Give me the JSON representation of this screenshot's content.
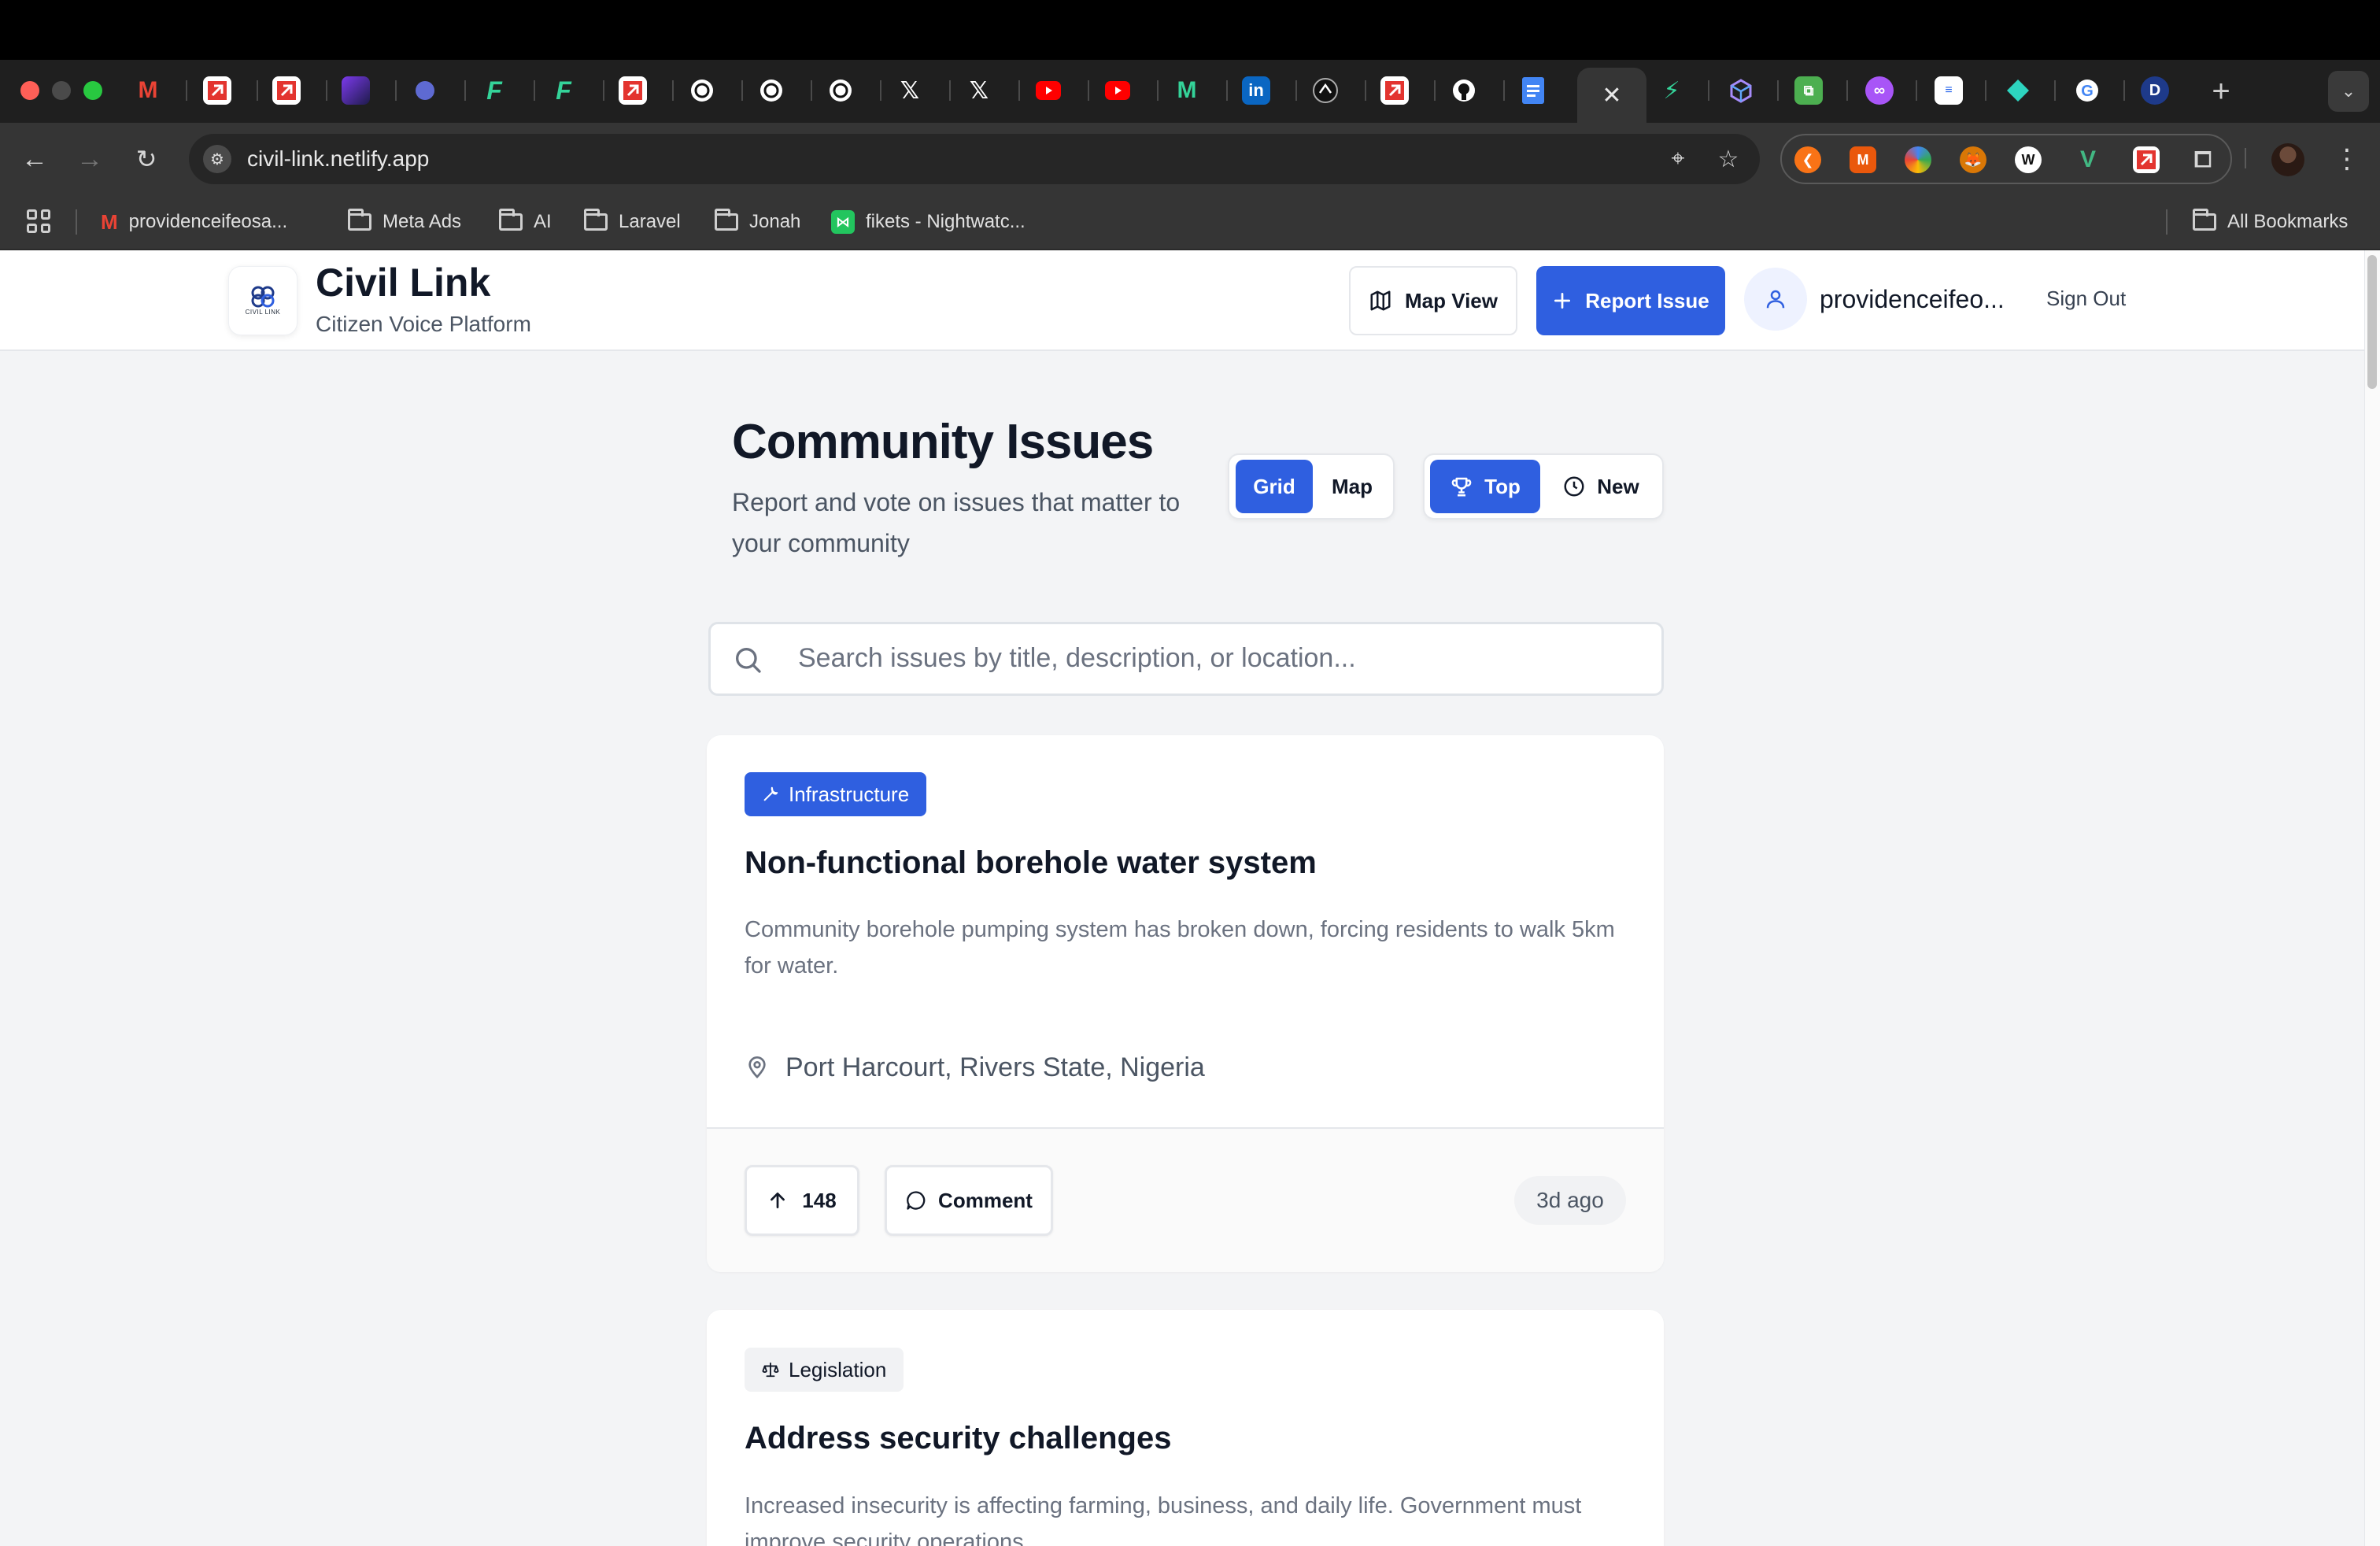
{
  "browser": {
    "url": "civil-link.netlify.app",
    "colors": {
      "frame": "#1f1f1f",
      "toolbar": "#353535",
      "omnibox": "#262626"
    },
    "tabs": [
      {
        "icon": "gmail-icon"
      },
      {
        "icon": "laravel-cloud-icon"
      },
      {
        "icon": "laravel-cloud-icon"
      },
      {
        "icon": "purple-app-icon"
      },
      {
        "icon": "linear-icon"
      },
      {
        "icon": "f-app-icon"
      },
      {
        "icon": "f-app-icon"
      },
      {
        "icon": "laravel-cloud-icon"
      },
      {
        "icon": "chatgpt-icon"
      },
      {
        "icon": "chatgpt-icon"
      },
      {
        "icon": "chatgpt-icon"
      },
      {
        "icon": "x-icon"
      },
      {
        "icon": "x-icon"
      },
      {
        "icon": "youtube-icon"
      },
      {
        "icon": "youtube-icon"
      },
      {
        "icon": "m-app-icon"
      },
      {
        "icon": "linkedin-icon"
      },
      {
        "icon": "ai-app-icon"
      },
      {
        "icon": "laravel-cloud-icon"
      },
      {
        "icon": "github-icon"
      },
      {
        "icon": "google-docs-icon"
      },
      {
        "icon": "close-icon",
        "active": true
      },
      {
        "icon": "bolt-icon"
      },
      {
        "icon": "cube-icon"
      },
      {
        "icon": "green-app-icon"
      },
      {
        "icon": "purple-loop-icon"
      },
      {
        "icon": "doc-app-icon"
      },
      {
        "icon": "teal-diamond-icon"
      },
      {
        "icon": "google-icon"
      },
      {
        "icon": "d-app-icon"
      }
    ],
    "bookmarks": [
      {
        "label": "providenceifeosa...",
        "icon": "gmail-icon"
      },
      {
        "label": "Meta Ads",
        "icon": "folder-icon"
      },
      {
        "label": "AI",
        "icon": "folder-icon"
      },
      {
        "label": "Laravel",
        "icon": "folder-icon"
      },
      {
        "label": "Jonah",
        "icon": "folder-icon"
      },
      {
        "label": "fikets - Nightwatc...",
        "icon": "nightwatch-icon"
      },
      {
        "label": "All Bookmarks",
        "icon": "folder-icon"
      }
    ],
    "all_bookmarks_label": "All Bookmarks"
  },
  "header": {
    "logo_text": "CIVIL LINK",
    "title": "Civil Link",
    "subtitle": "Citizen Voice Platform",
    "map_view_label": "Map View",
    "report_issue_label": "Report Issue",
    "user_name": "providenceifeo...",
    "sign_out_label": "Sign Out"
  },
  "main": {
    "title": "Community Issues",
    "subtitle": "Report and vote on issues that matter to your community",
    "view_toggle": {
      "grid_label": "Grid",
      "map_label": "Map",
      "selected": "Grid"
    },
    "sort_toggle": {
      "top_label": "Top",
      "new_label": "New",
      "selected": "Top"
    },
    "search": {
      "placeholder": "Search issues by title, description, or location...",
      "value": ""
    },
    "accent_color": "#2f5fe0",
    "issues": [
      {
        "category": "Infrastructure",
        "category_icon": "wrench-icon",
        "title": "Non-functional borehole water system",
        "description": "Community borehole pumping system has broken down, forcing residents to walk 5km for water.",
        "location": "Port Harcourt, Rivers State, Nigeria",
        "votes": "148",
        "comment_label": "Comment",
        "time": "3d ago"
      },
      {
        "category": "Legislation",
        "category_icon": "scales-icon",
        "title": "Address security challenges",
        "description": "Increased insecurity is affecting farming, business, and daily life. Government must improve security operations."
      }
    ]
  }
}
